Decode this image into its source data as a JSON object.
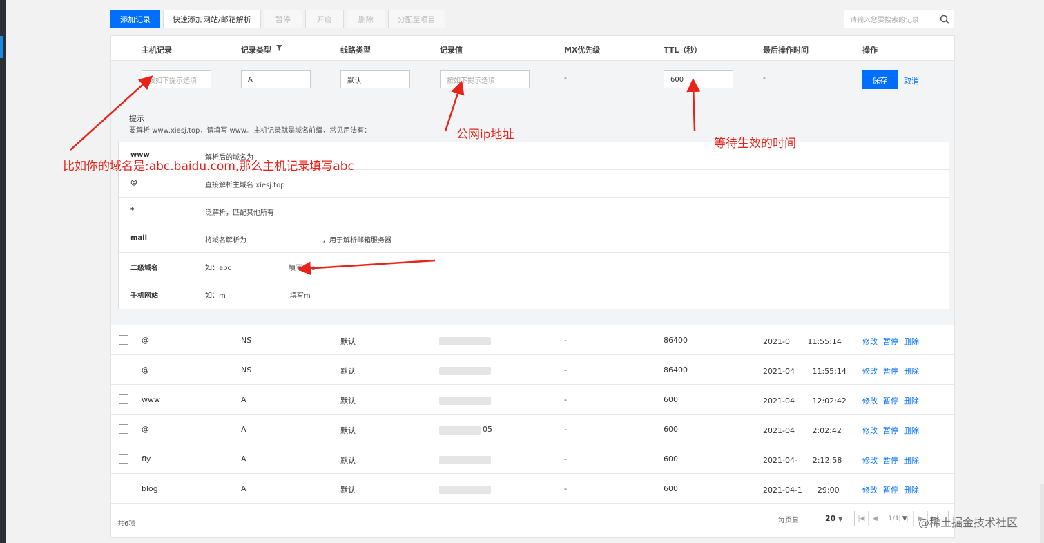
{
  "toolbar": {
    "add_record": "添加记录",
    "quick_add": "快速添加网站/邮箱解析",
    "pause": "暂停",
    "enable": "开启",
    "delete": "删除",
    "assign_project": "分配至项目"
  },
  "search": {
    "placeholder": "请输入您要搜索的记录"
  },
  "columns": {
    "host": "主机记录",
    "type": "记录类型",
    "line": "线路类型",
    "value": "记录值",
    "mx": "MX优先级",
    "ttl": "TTL（秒）",
    "last_op": "最后操作时间",
    "actions": "操作"
  },
  "edit_row": {
    "host_placeholder": "按如下提示选填",
    "type": "A",
    "line": "默认",
    "value_placeholder": "按如下提示选填",
    "mx": "-",
    "ttl": "600",
    "last_op": "-",
    "save": "保存",
    "cancel": "取消"
  },
  "hint": {
    "title": "提示",
    "desc": "要解析 www.xiesj.top，请填写 www。主机记录就是域名前缀，常见用法有：",
    "rows": [
      {
        "key": "www",
        "value": "解析后的域名为"
      },
      {
        "key": "@",
        "value": "直接解析主域名 xiesj.top"
      },
      {
        "key": "*",
        "value": "泛解析，匹配其他所有"
      },
      {
        "key": "mail",
        "value": "将域名解析为　　　　　　　　　　　，用于解析邮箱服务器"
      },
      {
        "key": "二级域名",
        "value": "如：abc　　　　　　　　 填写abc"
      },
      {
        "key": "手机网站",
        "value": "如：m　　　　　　　　　 填写m"
      }
    ]
  },
  "records": [
    {
      "host": "@",
      "type": "NS",
      "line": "默认",
      "value": "",
      "mx": "-",
      "ttl": "86400",
      "time": "2021-0　　 11:55:14"
    },
    {
      "host": "@",
      "type": "NS",
      "line": "默认",
      "value": "",
      "mx": "-",
      "ttl": "86400",
      "time": "2021-04　　 11:55:14"
    },
    {
      "host": "www",
      "type": "A",
      "line": "默认",
      "value": "",
      "mx": "-",
      "ttl": "600",
      "time": "2021-04　　 12:02:42"
    },
    {
      "host": "@",
      "type": "A",
      "line": "默认",
      "value": "05",
      "mx": "-",
      "ttl": "600",
      "time": "2021-04　　 2:02:42"
    },
    {
      "host": "fly",
      "type": "A",
      "line": "默认",
      "value": "",
      "mx": "-",
      "ttl": "600",
      "time": "2021-04-　　2:12:58"
    },
    {
      "host": "blog",
      "type": "A",
      "line": "默认",
      "value": "",
      "mx": "-",
      "ttl": "600",
      "time": "2021-04-1　　29:00"
    }
  ],
  "row_actions": {
    "edit": "修改",
    "pause": "暂停",
    "delete": "删除"
  },
  "footer": {
    "total": "共6项",
    "per_page_label": "每页显",
    "per_page": "20",
    "page": "1/1"
  },
  "annotations": {
    "host_hint": "比如你的域名是:abc.baidu.com,那么主机记录填写abc",
    "value_hint": "公网ip地址",
    "ttl_hint": "等待生效的时间"
  },
  "watermark": "@稀土掘金技术社区",
  "colors": {
    "primary": "#006eff",
    "annotation": "#e8231a"
  }
}
